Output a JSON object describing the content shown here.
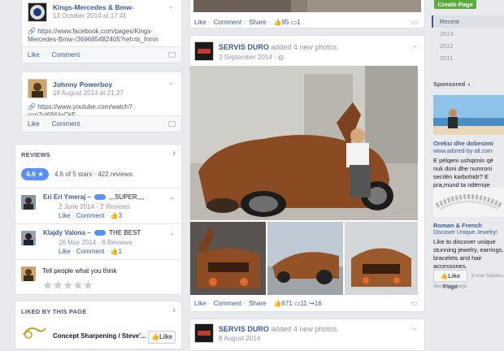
{
  "colors": {
    "brand": "#3b5998",
    "accent": "#5890ff",
    "create": "#5bab3d",
    "background": "#e9eaed"
  },
  "shared_posts": [
    {
      "name": "Kings-Mercedes & Bmw-",
      "date": "13 October 2014 at 17:41",
      "link": "https://www.facebook.com/pages/Kings-Mercedes-Bmw-/369685482405?ref=ts_fnmn",
      "actions": {
        "like": "Like",
        "comment": "Comment"
      }
    },
    {
      "name": "Johnny Powerboy",
      "date": "18 August 2014 at 21:27",
      "link": "https://www.youtube.com/watch?v=p7yI6NUoCkE",
      "actions": {
        "like": "Like",
        "comment": "Comment"
      }
    }
  ],
  "reviews": {
    "header": "REVIEWS",
    "rating": "4.6 ★",
    "summary": "4.6 of 5 stars · 422 reviews",
    "items": [
      {
        "author": "Eri Eri Ymeraj –",
        "text": ",,,SUPER,,,,",
        "date": "2 June 2014 · 2 Reviews",
        "like": "Like",
        "comment": "Comment",
        "likes": "3"
      },
      {
        "author": "Klajdy Valona –",
        "text": "THE BEST",
        "date": "26 May 2014 · 8 Reviews",
        "like": "Like",
        "comment": "Comment",
        "likes": "1"
      }
    ],
    "prompt": "Tell people what you think",
    "stars": "★★★★★"
  },
  "liked_by": {
    "header": "LIKED BY THIS PAGE",
    "item": "Concept Sharpening / Steve'...",
    "like_button": "Like"
  },
  "top_post_actions": {
    "like": "Like",
    "comment": "Comment",
    "share": "Share",
    "likes": "95",
    "comments": "1"
  },
  "main_post": {
    "page": "SERVIS DURO",
    "verb": "added 4 new photos.",
    "date": "3 September 2014",
    "actions": {
      "like": "Like",
      "comment": "Comment",
      "share": "Share",
      "likes": "671",
      "comments": "11",
      "shares": "16"
    }
  },
  "next_post": {
    "page": "SERVIS DURO",
    "verb": "added 4 new photos.",
    "date": "8 August 2014"
  },
  "sidebar": {
    "create_page": "Create Page",
    "years": [
      "Recent",
      "2013",
      "2012",
      "2011"
    ],
    "sponsored": "Sponsored",
    "ad1": {
      "title": "Oreksi dhe dobesimi",
      "url": "www.adored-by-all.com",
      "text": "E pëlqeni ushqimin që nuk doni dhe numroni secilën karbohidr? E pra,mund ta ndërroje këtë."
    },
    "ad2": {
      "title": "Roman & French",
      "subtitle": "Discover Unique Jewelry!",
      "text": "Like to discover unique stunning jewelry, earrings, bracelets and hair accessories.",
      "like_button": "Like Page",
      "liker": "Enise Saliaku",
      "liker_note": "likes this page."
    }
  }
}
